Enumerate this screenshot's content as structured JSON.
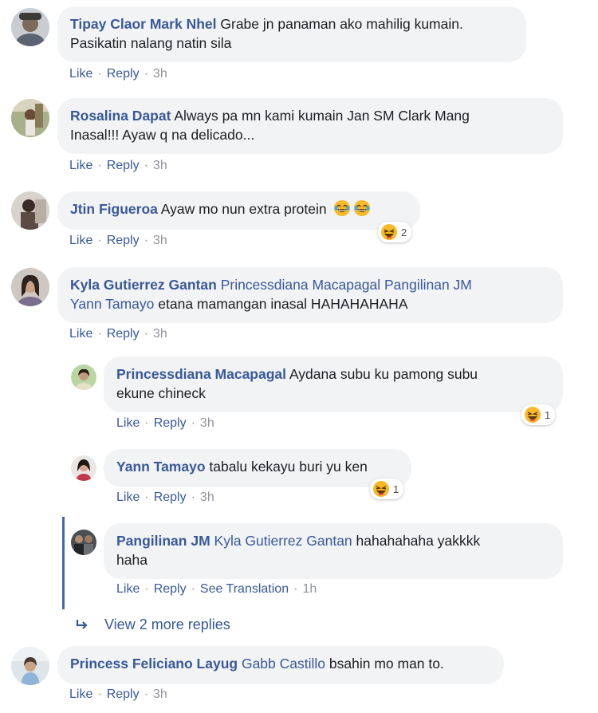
{
  "comments": [
    {
      "author": "Tipay Claor Mark Nhel",
      "text_line1": "Grabe jn panaman ako mahilig kumain.",
      "text_line2": "Pasikatin nalang natin sila",
      "like": "Like",
      "reply": "Reply",
      "time": "3h"
    },
    {
      "author": "Rosalina Dapat",
      "text_line1": "Always pa mn kami kumain Jan SM Clark Mang",
      "text_line2": "Inasal!!! Ayaw q na delicado...",
      "like": "Like",
      "reply": "Reply",
      "time": "3h"
    },
    {
      "author": "Jtin Figueroa",
      "text": "Ayaw mo nun extra protein",
      "like": "Like",
      "reply": "Reply",
      "time": "3h",
      "reaction_count": "2"
    },
    {
      "author": "Kyla Gutierrez Gantan",
      "tagged_line1": "Princessdiana Macapagal Pangilinan JM",
      "tagged_line2": "Yann Tamayo",
      "text": "etana mamangan inasal HAHAHAHAHA",
      "like": "Like",
      "reply": "Reply",
      "time": "3h",
      "replies": [
        {
          "author": "Princessdiana Macapagal",
          "text_line1": "Aydana subu ku pamong subu",
          "text_line2": "ekune chineck",
          "like": "Like",
          "reply": "Reply",
          "time": "3h",
          "reaction_count": "1"
        },
        {
          "author": "Yann Tamayo",
          "text": "tabalu kekayu buri yu ken",
          "like": "Like",
          "reply": "Reply",
          "time": "3h",
          "reaction_count": "1"
        },
        {
          "author": "Pangilinan JM",
          "tagged": "Kyla Gutierrez Gantan",
          "text_line1": "hahahahaha yakkkk",
          "text_line2": "haha",
          "like": "Like",
          "reply": "Reply",
          "translate": "See Translation",
          "time": "1h"
        }
      ],
      "more_replies": "View 2 more replies"
    },
    {
      "author": "Princess Feliciano Layug",
      "tagged": "Gabb Castillo",
      "text": "bsahin mo man to.",
      "like": "Like",
      "reply": "Reply",
      "time": "3h"
    }
  ],
  "icons": {
    "reaction": "laughing-tears-emoji",
    "reply_arrow": "reply-arrow-icon"
  },
  "colors": {
    "link": "#385898",
    "bubble": "#f2f3f5",
    "meta": "#90949c",
    "thread_line": "#4267b2"
  }
}
